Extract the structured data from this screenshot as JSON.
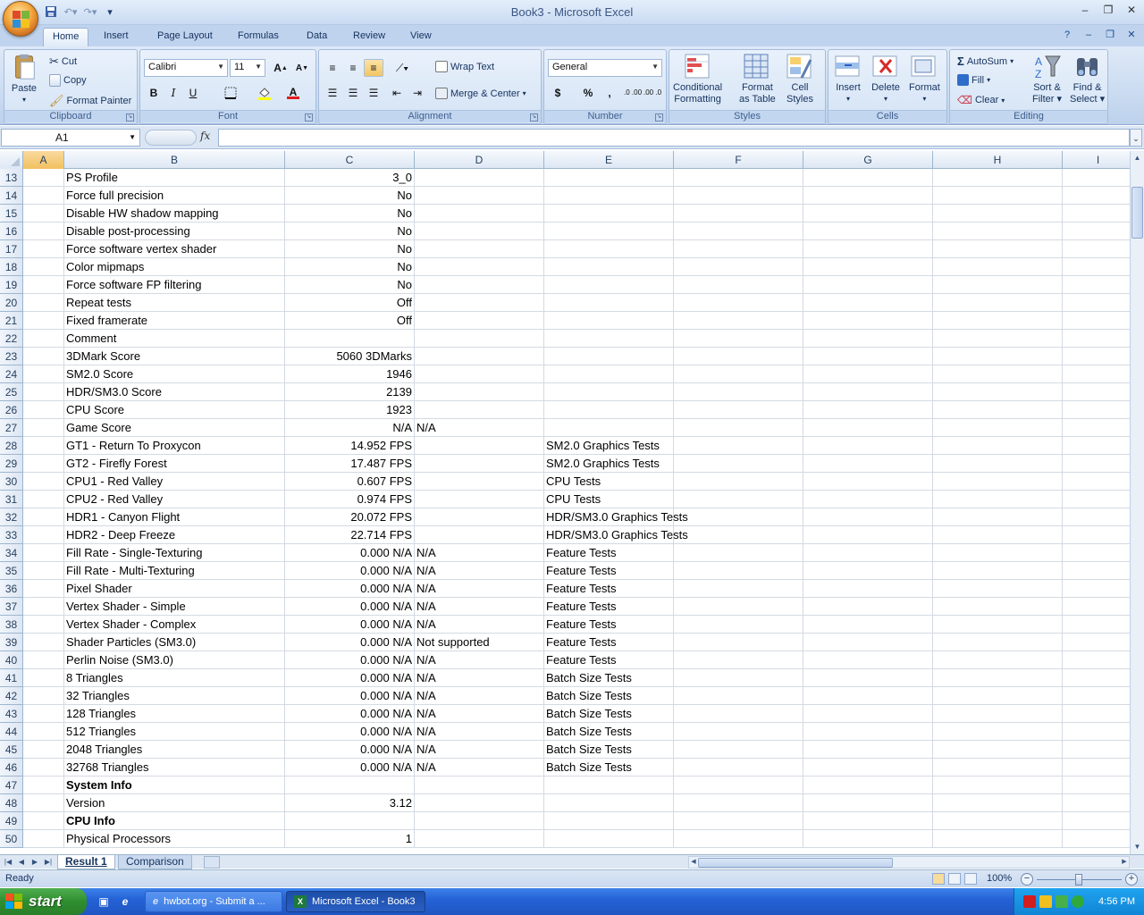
{
  "window": {
    "title": "Book3 - Microsoft Excel"
  },
  "tabs": [
    {
      "label": "Home"
    },
    {
      "label": "Insert"
    },
    {
      "label": "Page Layout"
    },
    {
      "label": "Formulas"
    },
    {
      "label": "Data"
    },
    {
      "label": "Review"
    },
    {
      "label": "View"
    }
  ],
  "ribbon": {
    "clipboard": {
      "group": "Clipboard",
      "paste": "Paste",
      "cut": "Cut",
      "copy": "Copy",
      "format_painter": "Format Painter"
    },
    "font": {
      "group": "Font",
      "name": "Calibri",
      "size": "11",
      "bold": "B",
      "italic": "I",
      "underline": "U",
      "grow": "A",
      "shrink": "A",
      "color": "A"
    },
    "alignment": {
      "group": "Alignment",
      "wrap": "Wrap Text",
      "merge": "Merge & Center"
    },
    "number": {
      "group": "Number",
      "format": "General",
      "currency": "$",
      "percent": "%",
      "comma": ",",
      "inc": ".0 .00",
      "dec": ".00 .0"
    },
    "styles": {
      "group": "Styles",
      "conditional": [
        "Conditional",
        "Formatting"
      ],
      "table": [
        "Format",
        "as Table"
      ],
      "cell": [
        "Cell",
        "Styles"
      ]
    },
    "cells": {
      "group": "Cells",
      "insert": "Insert",
      "delete": "Delete",
      "format": "Format"
    },
    "editing": {
      "group": "Editing",
      "autosum": "AutoSum",
      "fill": "Fill",
      "clear": "Clear",
      "sort": [
        "Sort &",
        "Filter"
      ],
      "find": [
        "Find &",
        "Select"
      ]
    }
  },
  "formula_bar": {
    "name_box": "A1",
    "fx": "fx",
    "formula": ""
  },
  "columns": [
    "A",
    "B",
    "C",
    "D",
    "E",
    "F",
    "G",
    "H",
    "I"
  ],
  "rows": [
    {
      "n": "13",
      "b": "PS Profile",
      "c": "3_0",
      "d": "",
      "e": ""
    },
    {
      "n": "14",
      "b": "Force full precision",
      "c": "No",
      "d": "",
      "e": ""
    },
    {
      "n": "15",
      "b": "Disable HW shadow mapping",
      "c": "No",
      "d": "",
      "e": ""
    },
    {
      "n": "16",
      "b": "Disable post-processing",
      "c": "No",
      "d": "",
      "e": ""
    },
    {
      "n": "17",
      "b": "Force software vertex shader",
      "c": "No",
      "d": "",
      "e": ""
    },
    {
      "n": "18",
      "b": "Color mipmaps",
      "c": "No",
      "d": "",
      "e": ""
    },
    {
      "n": "19",
      "b": "Force software FP filtering",
      "c": "No",
      "d": "",
      "e": ""
    },
    {
      "n": "20",
      "b": "Repeat tests",
      "c": "Off",
      "d": "",
      "e": ""
    },
    {
      "n": "21",
      "b": "Fixed framerate",
      "c": "Off",
      "d": "",
      "e": ""
    },
    {
      "n": "22",
      "b": "Comment",
      "c": "",
      "d": "",
      "e": ""
    },
    {
      "n": "23",
      "b": "3DMark Score",
      "c": "5060 3DMarks",
      "d": "",
      "e": ""
    },
    {
      "n": "24",
      "b": "SM2.0 Score",
      "c": "1946",
      "d": "",
      "e": ""
    },
    {
      "n": "25",
      "b": "HDR/SM3.0 Score",
      "c": "2139",
      "d": "",
      "e": ""
    },
    {
      "n": "26",
      "b": "CPU Score",
      "c": "1923",
      "d": "",
      "e": ""
    },
    {
      "n": "27",
      "b": "Game Score",
      "c": "N/A",
      "d": "N/A",
      "e": ""
    },
    {
      "n": "28",
      "b": "GT1 - Return To Proxycon",
      "c": "14.952 FPS",
      "d": "",
      "e": "SM2.0 Graphics Tests"
    },
    {
      "n": "29",
      "b": "GT2 - Firefly Forest",
      "c": "17.487 FPS",
      "d": "",
      "e": "SM2.0 Graphics Tests"
    },
    {
      "n": "30",
      "b": "CPU1 - Red Valley",
      "c": "0.607 FPS",
      "d": "",
      "e": "CPU Tests"
    },
    {
      "n": "31",
      "b": "CPU2 - Red Valley",
      "c": "0.974 FPS",
      "d": "",
      "e": "CPU Tests"
    },
    {
      "n": "32",
      "b": "HDR1 - Canyon Flight",
      "c": "20.072 FPS",
      "d": "",
      "e": "HDR/SM3.0 Graphics Tests"
    },
    {
      "n": "33",
      "b": "HDR2 - Deep Freeze",
      "c": "22.714 FPS",
      "d": "",
      "e": "HDR/SM3.0 Graphics Tests"
    },
    {
      "n": "34",
      "b": "Fill Rate - Single-Texturing",
      "c": "0.000 N/A",
      "d": "N/A",
      "e": "Feature Tests"
    },
    {
      "n": "35",
      "b": "Fill Rate - Multi-Texturing",
      "c": "0.000 N/A",
      "d": "N/A",
      "e": "Feature Tests"
    },
    {
      "n": "36",
      "b": "Pixel Shader",
      "c": "0.000 N/A",
      "d": "N/A",
      "e": "Feature Tests"
    },
    {
      "n": "37",
      "b": "Vertex Shader - Simple",
      "c": "0.000 N/A",
      "d": "N/A",
      "e": "Feature Tests"
    },
    {
      "n": "38",
      "b": "Vertex Shader - Complex",
      "c": "0.000 N/A",
      "d": "N/A",
      "e": "Feature Tests"
    },
    {
      "n": "39",
      "b": "Shader Particles (SM3.0)",
      "c": "0.000 N/A",
      "d": "Not supported",
      "e": "Feature Tests"
    },
    {
      "n": "40",
      "b": "Perlin Noise (SM3.0)",
      "c": "0.000 N/A",
      "d": "N/A",
      "e": "Feature Tests"
    },
    {
      "n": "41",
      "b": "8 Triangles",
      "c": "0.000 N/A",
      "d": "N/A",
      "e": "Batch Size Tests"
    },
    {
      "n": "42",
      "b": "32 Triangles",
      "c": "0.000 N/A",
      "d": "N/A",
      "e": "Batch Size Tests"
    },
    {
      "n": "43",
      "b": "128 Triangles",
      "c": "0.000 N/A",
      "d": "N/A",
      "e": "Batch Size Tests"
    },
    {
      "n": "44",
      "b": "512 Triangles",
      "c": "0.000 N/A",
      "d": "N/A",
      "e": "Batch Size Tests"
    },
    {
      "n": "45",
      "b": "2048 Triangles",
      "c": "0.000 N/A",
      "d": "N/A",
      "e": "Batch Size Tests"
    },
    {
      "n": "46",
      "b": "32768 Triangles",
      "c": "0.000 N/A",
      "d": "N/A",
      "e": "Batch Size Tests"
    },
    {
      "n": "47",
      "b": "System Info",
      "c": "",
      "d": "",
      "e": "",
      "bold": true
    },
    {
      "n": "48",
      "b": "Version",
      "c": "3.12",
      "d": "",
      "e": ""
    },
    {
      "n": "49",
      "b": "CPU Info",
      "c": "",
      "d": "",
      "e": "",
      "bold": true
    },
    {
      "n": "50",
      "b": "Physical Processors",
      "c": "1",
      "d": "",
      "e": ""
    }
  ],
  "sheets": [
    {
      "label": "Result 1",
      "active": true
    },
    {
      "label": "Comparison",
      "active": false
    }
  ],
  "status": {
    "text": "Ready",
    "zoom": "100%"
  },
  "taskbar": {
    "start": "start",
    "tasks": [
      {
        "label": "hwbot.org - Submit a ..."
      },
      {
        "label": "Microsoft Excel - Book3"
      }
    ],
    "clock": "4:56 PM"
  }
}
